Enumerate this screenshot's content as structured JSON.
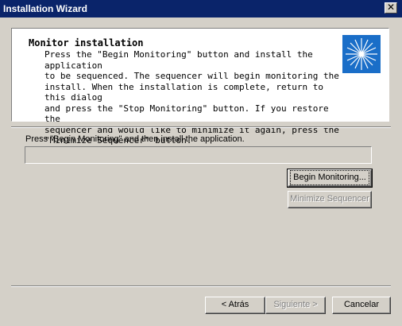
{
  "window": {
    "title": "Installation Wizard",
    "close_glyph": "✕"
  },
  "header": {
    "title": "Monitor installation",
    "description": "Press the \"Begin Monitoring\" button and install the application\nto be sequenced.  The sequencer will begin monitoring the\ninstall.  When the installation is complete, return to this dialog\nand press the \"Stop Monitoring\" button.  If you restore the\nsequencer and would like to minimize it again, press the\n\"Minimize Sequencer\" button.",
    "icon": "starburst-icon",
    "icon_color": "#1a6ec8"
  },
  "main": {
    "instruction": "Press \"Begin Monitoring\" and then install the application.",
    "progress": 0,
    "begin_button": "Begin Monitoring...",
    "minimize_button": "Minimize Sequencer"
  },
  "footer": {
    "back_button": "< Atrás",
    "next_button": "Siguiente >",
    "cancel_button": "Cancelar"
  }
}
